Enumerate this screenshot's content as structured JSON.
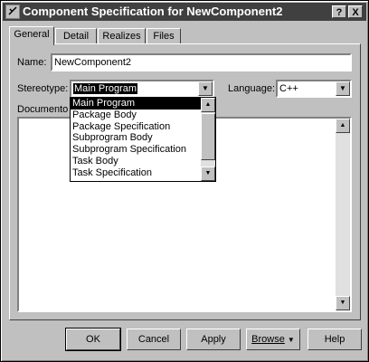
{
  "window": {
    "title": "Component Specification for NewComponent2"
  },
  "titlebar": {
    "help_label": "?",
    "close_label": "X"
  },
  "tabs": [
    {
      "label": "General"
    },
    {
      "label": "Detail"
    },
    {
      "label": "Realizes"
    },
    {
      "label": "Files"
    }
  ],
  "form": {
    "name_label": "Name:",
    "name_value": "NewComponent2",
    "stereotype_label": "Stereotype:",
    "stereotype_value": "Main Program",
    "language_label": "Language:",
    "language_value": "C++",
    "documentation_label": "Documento"
  },
  "stereotype_options": [
    "Main Program",
    "Package Body",
    "Package Specification",
    "Subprogram Body",
    "Subprogram Specification",
    "Task Body",
    "Task Specification"
  ],
  "buttons": {
    "ok": "OK",
    "cancel": "Cancel",
    "apply": "Apply",
    "browse": "Browse",
    "help": "Help"
  },
  "icons": {
    "dropdown": "chevron-down-icon",
    "scroll_up": "arrow-up-icon",
    "scroll_down": "arrow-down-icon",
    "app": "component-icon"
  },
  "colors": {
    "titlebar": "#404040",
    "face": "#c0c0c0",
    "selection": "#000000"
  }
}
